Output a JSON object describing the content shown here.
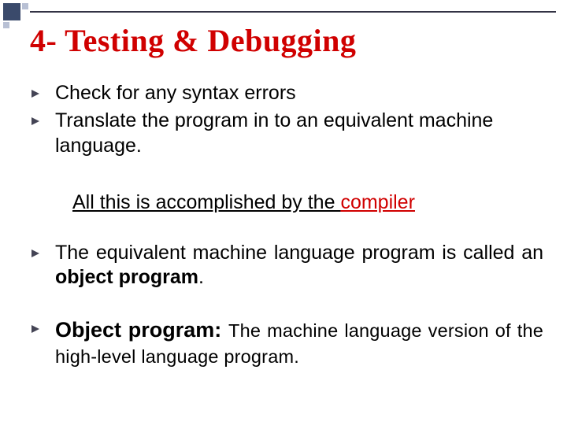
{
  "title": "4- Testing & Debugging",
  "bullets": {
    "b1": "Check for any syntax errors",
    "b2": "Translate the program in to an equivalent machine language."
  },
  "mid": {
    "prefix": "All this is accomplished by the ",
    "compiler": "compiler"
  },
  "b3": {
    "part1": "The equivalent machine language program is called an ",
    "bold": "object program",
    "part2": "."
  },
  "b4": {
    "label": " Object program: ",
    "rest": "The machine language version of the high-level language program."
  },
  "colors": {
    "accent": "#d00000",
    "corner_dark": "#3a4a6b",
    "corner_light": "#b8c0d4"
  }
}
